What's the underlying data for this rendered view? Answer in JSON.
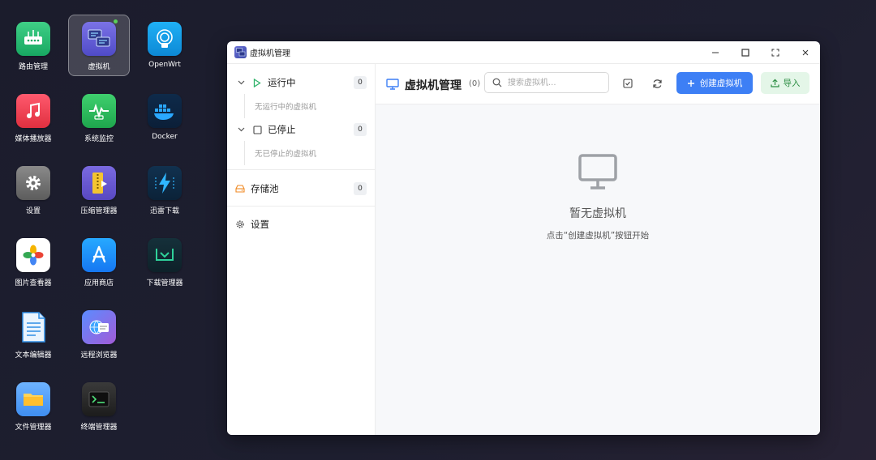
{
  "desktop": {
    "icons": [
      {
        "label": "路由管理"
      },
      {
        "label": "虚拟机"
      },
      {
        "label": "OpenWrt"
      },
      {
        "label": "媒体播放器"
      },
      {
        "label": "系统监控"
      },
      {
        "label": "Docker"
      },
      {
        "label": "设置"
      },
      {
        "label": "压缩管理器"
      },
      {
        "label": "迅雷下载"
      },
      {
        "label": "图片查看器"
      },
      {
        "label": "应用商店"
      },
      {
        "label": "下载管理器"
      },
      {
        "label": "文本编辑器"
      },
      {
        "label": "远程浏览器"
      },
      {
        "label": "文件管理器"
      },
      {
        "label": "终端管理器"
      }
    ]
  },
  "window": {
    "title": "虚拟机管理",
    "controls": [
      "minimize-icon",
      "maximize-icon",
      "fullscreen-icon",
      "close-icon"
    ]
  },
  "sidebar": {
    "running": {
      "label": "运行中",
      "count": "0",
      "empty": "无运行中的虚拟机"
    },
    "stopped": {
      "label": "已停止",
      "count": "0",
      "empty": "无已停止的虚拟机"
    },
    "storage": {
      "label": "存储池",
      "count": "0"
    },
    "settings": {
      "label": "设置"
    }
  },
  "toolbar": {
    "title": "虚拟机管理",
    "count": "(0)",
    "search_placeholder": "搜索虚拟机...",
    "create_label": "创建虚拟机",
    "import_label": "导入"
  },
  "empty_state": {
    "title": "暂无虚拟机",
    "subtitle": "点击“创建虚拟机”按钮开始"
  },
  "colors": {
    "accent": "#3d7ff5",
    "import_bg": "#e4f6e8",
    "import_text": "#2f8f45",
    "running_icon": "#2fb36a",
    "storage_icon": "#f08a24"
  }
}
